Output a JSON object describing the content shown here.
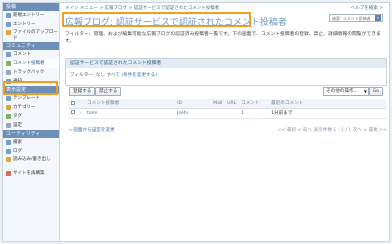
{
  "sidebar": {
    "sections": [
      {
        "head": "投稿",
        "items": [
          {
            "label": "新規エントリー",
            "icon": "new-entry-icon"
          },
          {
            "label": "エントリー",
            "icon": "entry-icon"
          },
          {
            "label": "ファイルのアップロード",
            "icon": "upload-icon"
          }
        ]
      },
      {
        "head": "コミュニティ",
        "items": [
          {
            "label": "コメント",
            "icon": "comment-icon"
          },
          {
            "label": "コメント投稿者",
            "icon": "commenter-icon",
            "active": true
          },
          {
            "label": "トラックバック",
            "icon": "trackback-icon"
          },
          {
            "label": "通知",
            "icon": "notify-icon"
          }
        ]
      },
      {
        "head": "表示設定",
        "items": [
          {
            "label": "テンプレート",
            "icon": "template-icon"
          },
          {
            "label": "カテゴリー",
            "icon": "category-icon"
          },
          {
            "label": "タグ",
            "icon": "tag-icon"
          },
          {
            "label": "設定",
            "icon": "settings-icon"
          }
        ]
      },
      {
        "head": "ユーティリティ",
        "items": [
          {
            "label": "検索",
            "icon": "search-icon"
          },
          {
            "label": "ログ",
            "icon": "log-icon"
          },
          {
            "label": "読み込み/書き出し",
            "icon": "import-export-icon"
          },
          {
            "label": "サイトを再構築",
            "icon": "rebuild-icon"
          }
        ]
      }
    ]
  },
  "header": {
    "breadcrumb": "メイン メニュー > 広報ブログ > 認証サービスで認証されたコメント投稿者",
    "help": "ヘルプを検索 >",
    "title": "広報ブログ: 認証サービスで認証されたコメント投稿者",
    "search_placeholder": "検索: コメント投稿者"
  },
  "description": "フィルター、管理、および編集可能な広報ブログの認証済み投稿者一覧です。下の画面で、コメント投稿者の登録、禁止、詳細情報の閲覧ができます。",
  "panel": {
    "head": "認証サービスで認証されたコメント投稿者",
    "filter_label": "フィルター:",
    "filter_value": "なし",
    "filter_link": "すべて (条件を変更する)"
  },
  "toolbar": {
    "register": "登録する",
    "ban": "禁止する",
    "action_select": "その他の操作...",
    "go": "Go"
  },
  "table": {
    "headers": [
      "",
      "",
      "コメント投稿者",
      "ID",
      "Mail",
      "URL",
      "コメント",
      "最近のコメント"
    ],
    "rows": [
      {
        "star": "☆",
        "name": "tomi",
        "id": "Jsehi",
        "mail": "",
        "url": "",
        "comments": "1",
        "last": "1分前まで"
      }
    ]
  },
  "footer": {
    "back": "« 画面から設定を変更",
    "pager": "<< 最初 < 前へ  表示件数 1 - 1 / 1  次へ > 最後 >>"
  }
}
